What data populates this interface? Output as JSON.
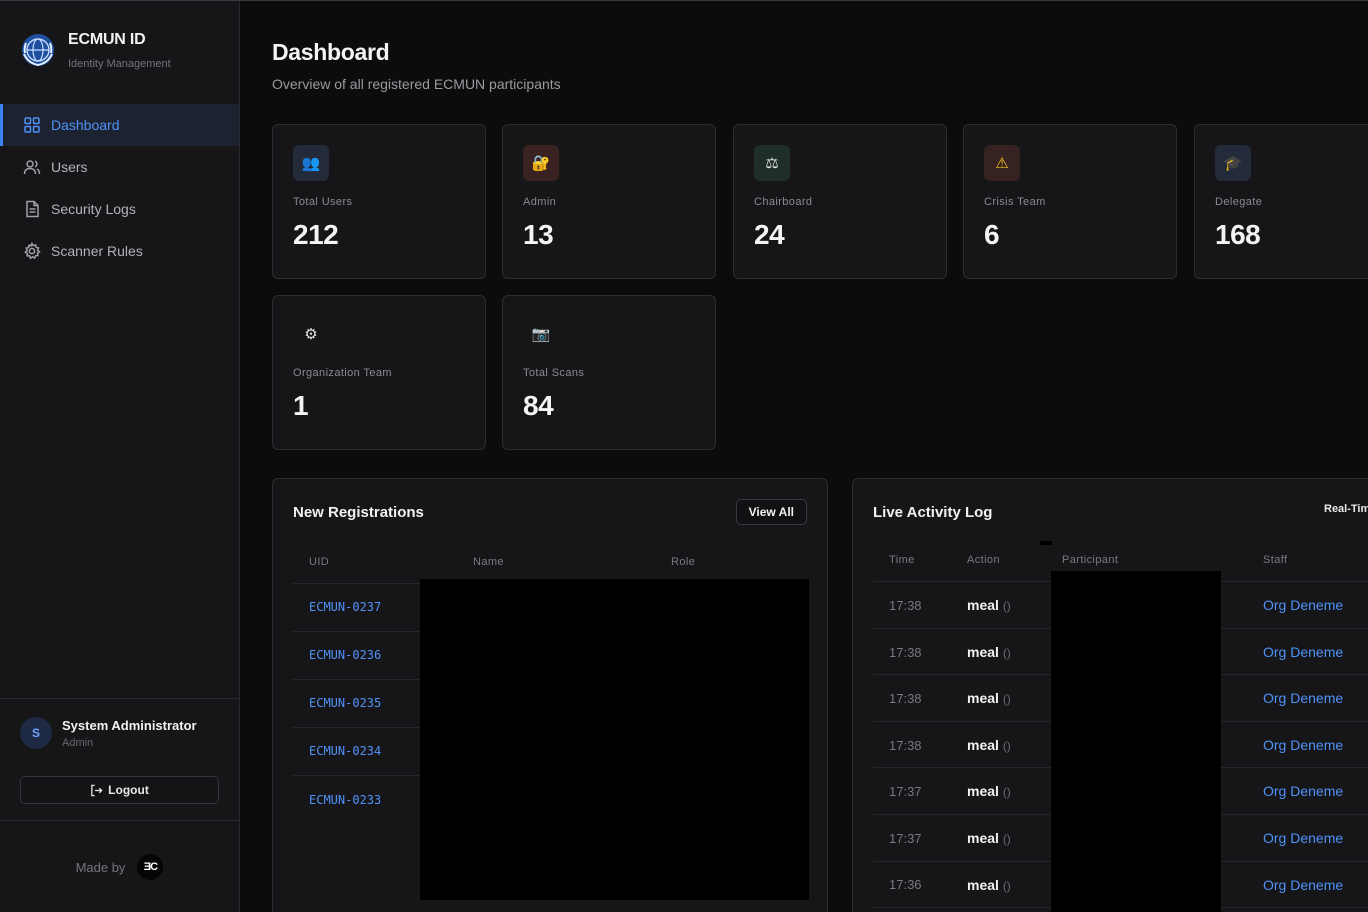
{
  "brand": {
    "title": "ECMUN ID",
    "subtitle": "Identity Management",
    "logo_icon": "globe-emblem-icon"
  },
  "sidebar": {
    "items": [
      {
        "label": "Dashboard",
        "icon": "grid-icon",
        "active": true
      },
      {
        "label": "Users",
        "icon": "users-icon",
        "active": false
      },
      {
        "label": "Security Logs",
        "icon": "document-icon",
        "active": false
      },
      {
        "label": "Scanner Rules",
        "icon": "gear-icon",
        "active": false
      }
    ],
    "user": {
      "initial": "S",
      "name": "System Administrator",
      "role": "Admin"
    },
    "logout_label": "Logout",
    "made_by_label": "Made by",
    "made_by_logo": "ƎC"
  },
  "header": {
    "title": "Dashboard",
    "subtitle": "Overview of all registered ECMUN participants"
  },
  "stats": [
    {
      "label": "Total Users",
      "value": "212",
      "icon": "👥",
      "icon_name": "users-icon"
    },
    {
      "label": "Admin",
      "value": "13",
      "icon": "🔐",
      "icon_name": "lock-icon"
    },
    {
      "label": "Chairboard",
      "value": "24",
      "icon": "⚖",
      "icon_name": "gavel-icon"
    },
    {
      "label": "Crisis Team",
      "value": "6",
      "icon": "⚠",
      "icon_name": "warning-icon"
    },
    {
      "label": "Delegate",
      "value": "168",
      "icon": "🎓",
      "icon_name": "graduation-cap-icon"
    },
    {
      "label": "Organization Team",
      "value": "1",
      "icon": "⚙",
      "icon_name": "gear-icon"
    },
    {
      "label": "Total Scans",
      "value": "84",
      "icon": "📷",
      "icon_name": "camera-icon"
    }
  ],
  "registrations": {
    "title": "New Registrations",
    "view_all_label": "View All",
    "columns": [
      "UID",
      "Name",
      "Role"
    ],
    "rows": [
      {
        "uid": "ECMUN-0237"
      },
      {
        "uid": "ECMUN-0236"
      },
      {
        "uid": "ECMUN-0235"
      },
      {
        "uid": "ECMUN-0234"
      },
      {
        "uid": "ECMUN-0233"
      }
    ]
  },
  "activity": {
    "title": "Live Activity Log",
    "badge": "Real-Tim",
    "columns": [
      "Time",
      "Action",
      "Participant",
      "Staff"
    ],
    "rows": [
      {
        "time": "17:38",
        "action": "meal",
        "paren": "()",
        "staff": "Org Deneme"
      },
      {
        "time": "17:38",
        "action": "meal",
        "paren": "()",
        "staff": "Org Deneme"
      },
      {
        "time": "17:38",
        "action": "meal",
        "paren": "()",
        "staff": "Org Deneme"
      },
      {
        "time": "17:38",
        "action": "meal",
        "paren": "()",
        "staff": "Org Deneme"
      },
      {
        "time": "17:37",
        "action": "meal",
        "paren": "()",
        "staff": "Org Deneme"
      },
      {
        "time": "17:37",
        "action": "meal",
        "paren": "()",
        "staff": "Org Deneme"
      },
      {
        "time": "17:36",
        "action": "meal",
        "paren": "()",
        "staff": "Org Deneme"
      }
    ]
  },
  "colors": {
    "accent": "#3b82f6",
    "background": "#0c0c0d",
    "surface": "#161618"
  }
}
